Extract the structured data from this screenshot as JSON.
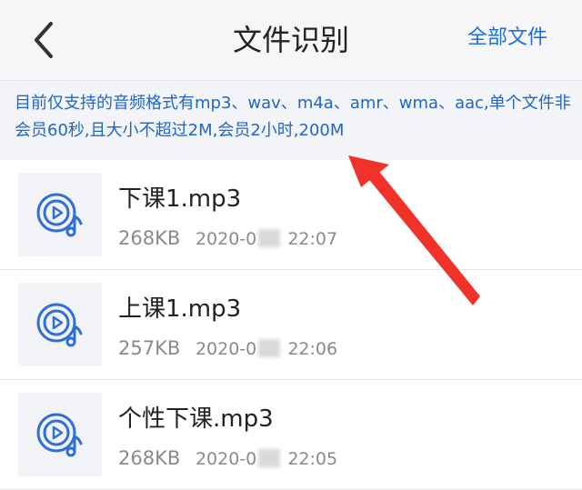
{
  "header": {
    "title": "文件识别",
    "all_files_label": "全部文件"
  },
  "notice": {
    "text": "目前仅支持的音频格式有mp3、wav、m4a、amr、wma、aac,单个文件非会员60秒,且大小不超过2M,会员2小时,200M"
  },
  "files": [
    {
      "name": "下课1.mp3",
      "size": "268KB",
      "date_prefix": "2020-0",
      "time": "22:07"
    },
    {
      "name": "上课1.mp3",
      "size": "257KB",
      "date_prefix": "2020-0",
      "time": "22:06"
    },
    {
      "name": "个性下课.mp3",
      "size": "268KB",
      "date_prefix": "2020-0",
      "time": "22:05"
    }
  ],
  "colors": {
    "accent": "#1e6fd9",
    "annotation": "#f0322a"
  },
  "icons": {
    "back": "chevron-left-icon",
    "file": "audio-file-icon"
  }
}
